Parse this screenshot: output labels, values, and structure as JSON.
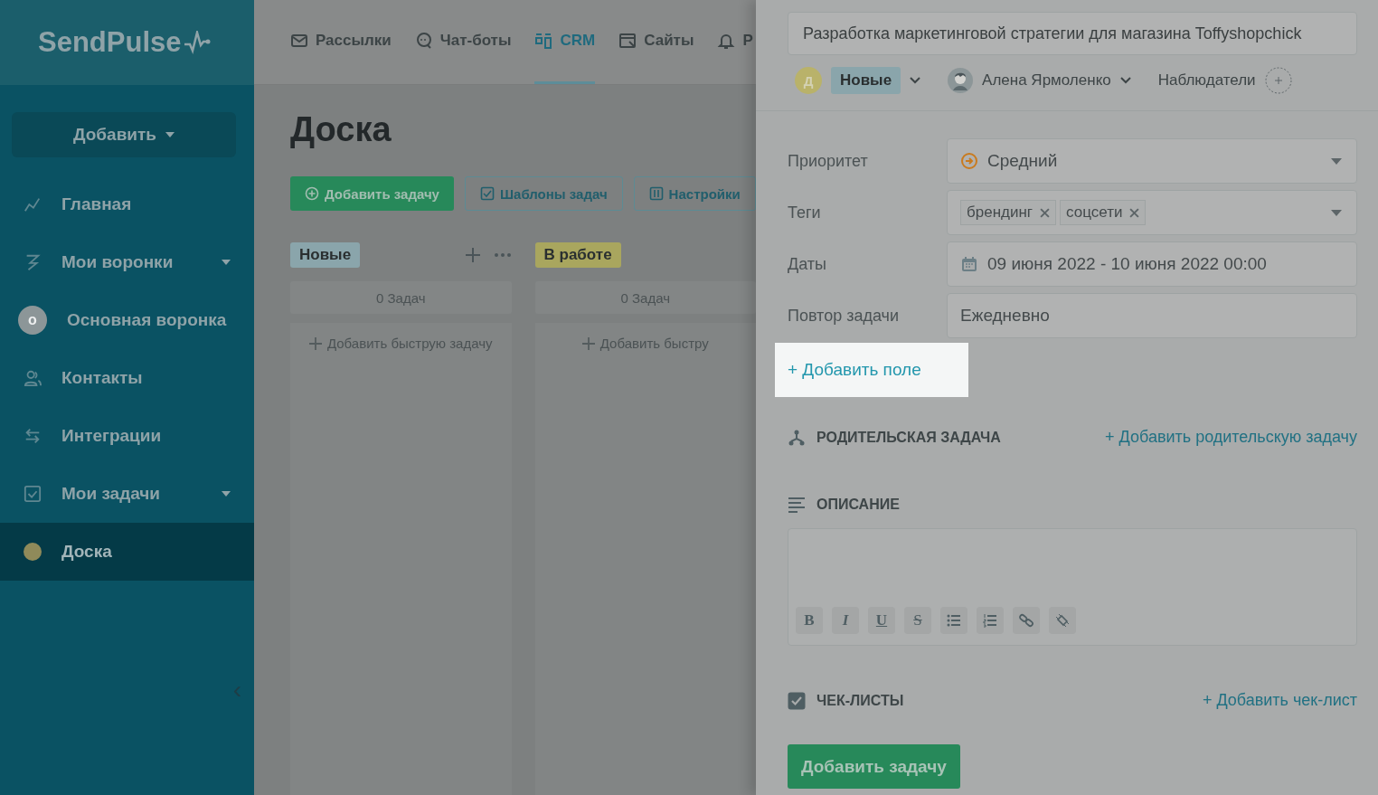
{
  "sidebar": {
    "logo": "SendPulse",
    "add_button": "Добавить",
    "collapse": "‹",
    "items": [
      {
        "label": "Главная",
        "selected": false,
        "expandable": false
      },
      {
        "label": "Мои воронки",
        "selected": false,
        "expandable": true
      },
      {
        "label": "Основная воронка",
        "selected": false,
        "expandable": false,
        "initial": "о"
      },
      {
        "label": "Контакты",
        "selected": false,
        "expandable": false
      },
      {
        "label": "Интеграции",
        "selected": false,
        "expandable": false
      },
      {
        "label": "Мои задачи",
        "selected": false,
        "expandable": true
      },
      {
        "label": "Доска",
        "selected": true,
        "expandable": false,
        "color": "#8f8a5a"
      }
    ]
  },
  "top_nav": [
    {
      "label": "Рассылки",
      "selected": false
    },
    {
      "label": "Чат-боты",
      "selected": false
    },
    {
      "label": "CRM",
      "selected": true
    },
    {
      "label": "Сайты",
      "selected": false
    },
    {
      "label": "Р",
      "selected": false
    }
  ],
  "board": {
    "title": "Доска",
    "buttons": [
      {
        "label": "Добавить задачу",
        "kind": "primary"
      },
      {
        "label": "Шаблоны задач",
        "kind": "outline"
      },
      {
        "label": "Настройки",
        "kind": "outline"
      }
    ],
    "columns": [
      {
        "name": "Новые",
        "color": "#8aa5ab",
        "count": "0 Задач",
        "quick_add": "Добавить быструю задачу",
        "menu": true
      },
      {
        "name": "В работе",
        "color": "#a9a65e",
        "count": "0 Задач",
        "quick_add": "Добавить быстру",
        "menu": false
      }
    ]
  },
  "task_panel": {
    "title": "Разработка маркетинговой стратегии для магазина Toffyshopchick",
    "status_initial": "Д",
    "status": "Новые",
    "assignee": "Алена Ярмоленко",
    "watchers": "Наблюдатели",
    "fields": [
      {
        "label": "Приоритет",
        "kind": "select",
        "value": "Средний"
      },
      {
        "label": "Теги",
        "kind": "tags",
        "tags": [
          "брендинг",
          "соцсети"
        ]
      },
      {
        "label": "Даты",
        "kind": "date",
        "value": "09 июня 2022 - 10 июня 2022 00:00"
      },
      {
        "label": "Повтор задачи",
        "kind": "text",
        "value": "Ежедневно"
      }
    ],
    "add_field": "+ Добавить поле",
    "parent": {
      "title": "РОДИТЕЛЬСКАЯ ЗАДАЧА",
      "link": "+ Добавить родительскую задачу"
    },
    "description": {
      "title": "ОПИСАНИЕ",
      "format_buttons": [
        "B",
        "I",
        "U",
        "S"
      ]
    },
    "checklists": {
      "title": "ЧЕК-ЛИСТЫ",
      "checked": true,
      "link": "+ Добавить чек-лист"
    },
    "submit": "Добавить задачу"
  }
}
